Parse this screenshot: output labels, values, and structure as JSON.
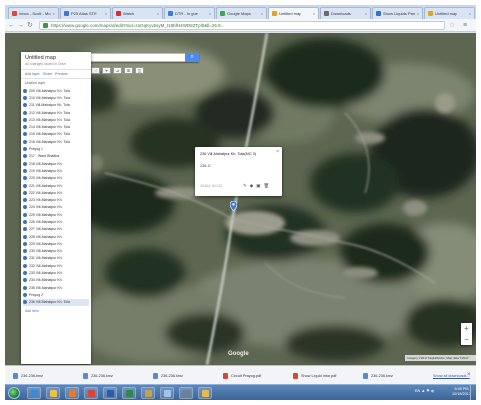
{
  "browser": {
    "tabs": [
      {
        "label": "Inbox - Scott - Mo",
        "color": "#d44"
      },
      {
        "label": "P25 Atlas STE",
        "color": "#4477cc"
      },
      {
        "label": "Watch",
        "color": "#cc3333"
      },
      {
        "label": "DTR - In gue",
        "color": "#3a7ed8"
      },
      {
        "label": "Google Maps",
        "color": "#3ba55a"
      },
      {
        "label": "Untitled map",
        "color": "#e4a22a"
      },
      {
        "label": "Downloads",
        "color": "#6a6a6a"
      },
      {
        "label": "Show Liquids Pan",
        "color": "#3b6fc4"
      },
      {
        "label": "Untitled map",
        "color": "#e4a22a"
      }
    ],
    "url": "https://www.google.com/maps/d/edit?mid=zaGqKyvbsyM_t18bfH4WD8ZTpl0&ll=25.8...",
    "back_icon": "back-arrow",
    "forward_icon": "forward-arrow",
    "reload_icon": "reload",
    "star_icon": "star",
    "menu_icon": "menu"
  },
  "map": {
    "search_placeholder": "",
    "search_button_icon": "search",
    "tools": [
      "☜",
      "⌖",
      "⊿",
      "⊞",
      "◫"
    ],
    "panel": {
      "title": "Untitled map",
      "subtitle": "All changes saved in Drive",
      "actions": [
        "Add layer",
        "Share",
        "Preview"
      ],
      "layer_name": "Untitled layer",
      "items": [
        "209 Vill-Mahatpur Kh. Tola",
        "210 Vill-Mahatpur Kh. Tola",
        "211 Vill-Mahatpur Kh. Tola",
        "212 Vill-Mahatpur Kh. Tola",
        "213 Vill-Mahatpur Kh. Tola",
        "214 Vill-Mahatpur Kh. Tola",
        "215 Vill-Mahatpur Kh. Tola",
        "216 Vill-Mahatpur Kh. Tola",
        "Prayog 1",
        "217 - Ward Bhattha",
        "218 Vill-Mahatpur Kh.",
        "219 Vill-Mahatpur Kh.",
        "220 Vill-Mahatpur Kh.",
        "221 Vill-Mahatpur Kh.",
        "222 Vill-Mahatpur Kh.",
        "223 Vill-Mahatpur Kh.",
        "224 Vill-Mahatpur Kh.",
        "225 Vill-Mahatpur Kh.",
        "226 Vill-Mahatpur Kh.",
        "227 Vill-Mahatpur Kh.",
        "228 Vill-Mahatpur Kh.",
        "229 Vill-Mahatpur Kh.",
        "230 Vill-Mahatpur Kh.",
        "231 Vill-Mahatpur Kh.",
        "232 Vill-Mahatpur Kh.",
        "233 Vill-Mahatpur Kh.",
        "234 Vill-Mahatpur Kh.",
        "235 Vill-Mahatpur Kh.",
        "Prayog 2",
        "236 Vill-Mahatpur Kh. Tola"
      ],
      "selected_index": 29,
      "more_label": "Add item"
    },
    "popup": {
      "title": "236 Vill-Mahatpur Kh. Tola(MC 3)",
      "value": "236-G",
      "footer": "25.814, 84.212",
      "icons": [
        "edit",
        "style",
        "camera",
        "delete"
      ],
      "close": "×"
    },
    "logo_text": "Google",
    "attribution": "Imagery ©2017 DigitalGlobe, Map data ©2017",
    "zoom_in": "+",
    "zoom_out": "−"
  },
  "downloads": {
    "items": [
      {
        "label": "236-236.kmz",
        "icon": "file"
      },
      {
        "label": "236-236.kmz",
        "icon": "file"
      },
      {
        "label": "236-236.kmz",
        "icon": "file"
      },
      {
        "label": "Circuit Prayog.pdf",
        "icon": "pdf"
      },
      {
        "label": "Show Liquid Infor.pdf",
        "icon": "pdf"
      },
      {
        "label": "236-236.kmz",
        "icon": "file"
      }
    ],
    "show_all": "Show all downloads...",
    "close": "×"
  },
  "taskbar": {
    "apps": [
      {
        "name": "internet-explorer",
        "color": "#3b8ad8"
      },
      {
        "name": "file-explorer",
        "color": "#e8c24a"
      },
      {
        "name": "media-player",
        "color": "#e67a2a"
      },
      {
        "name": "chrome",
        "color": "#d8443a"
      },
      {
        "name": "word",
        "color": "#2b5cab"
      },
      {
        "name": "excel",
        "color": "#2e8a4a"
      },
      {
        "name": "paint",
        "color": "#c6a04a"
      },
      {
        "name": "notepad",
        "color": "#9fc4e6"
      },
      {
        "name": "calculator",
        "color": "#6f7f90"
      },
      {
        "name": "folder",
        "color": "#e8b94a"
      }
    ],
    "tray_text": "EN ▲ ⚑ ◂)",
    "time": "6:45 PM",
    "date": "10/18/2017"
  }
}
